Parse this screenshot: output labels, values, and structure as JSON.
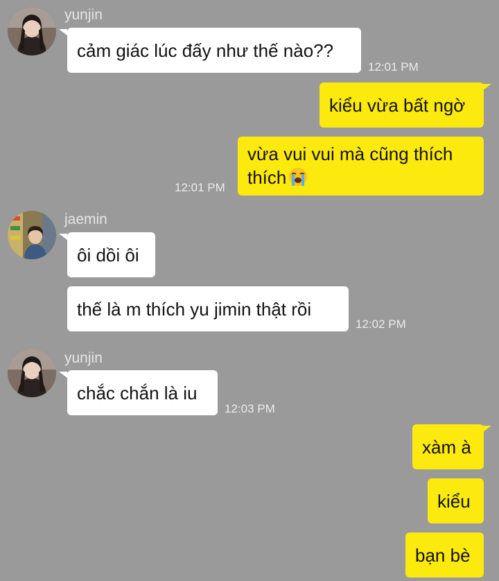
{
  "colors": {
    "background": "#9a9a9a",
    "incoming_bubble": "#ffffff",
    "outgoing_bubble": "#fce90d",
    "meta_text": "#ececec"
  },
  "messages": {
    "g1": {
      "sender": "yunjin",
      "avatar_icon": "avatar-yunjin",
      "text": "cảm giác lúc đấy như thế nào??",
      "time": "12:01 PM"
    },
    "o1": {
      "text1": "kiểu vừa bất ngờ",
      "text2": "vừa vui vui mà cũng thích thích",
      "emoji": "loudly-crying-face-icon",
      "time": "12:01 PM"
    },
    "g2": {
      "sender": "jaemin",
      "avatar_icon": "avatar-jaemin",
      "text1": "ôi dồi ôi",
      "text2": "thế là m thích yu jimin thật rồi",
      "time": "12:02 PM"
    },
    "g3": {
      "sender": "yunjin",
      "avatar_icon": "avatar-yunjin",
      "text": "chắc chắn là iu",
      "time": "12:03 PM"
    },
    "o2": {
      "text1": "xàm à",
      "text2": "kiểu",
      "text3": "bạn bè"
    }
  }
}
